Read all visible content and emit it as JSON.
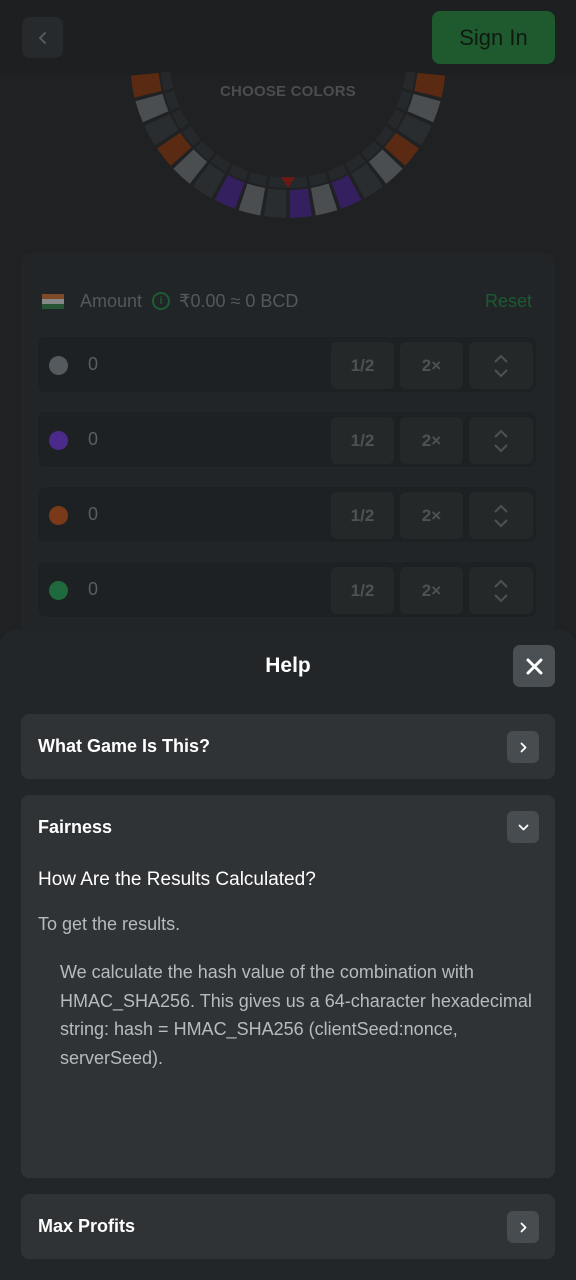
{
  "header": {
    "signin_label": "Sign In"
  },
  "wheel": {
    "title": "CHOOSE COLORS"
  },
  "amount": {
    "label": "Amount",
    "info_icon": "i",
    "value": "₹0.00 ≈ 0 BCD",
    "reset_label": "Reset"
  },
  "bets": [
    {
      "color_name": "gray",
      "color": "#555a5e",
      "value": "0",
      "half": "1/2",
      "double": "2×"
    },
    {
      "color_name": "purple",
      "color": "#4b2a8c",
      "value": "0",
      "half": "1/2",
      "double": "2×"
    },
    {
      "color_name": "orange",
      "color": "#7a3a1a",
      "value": "0",
      "half": "1/2",
      "double": "2×"
    },
    {
      "color_name": "green",
      "color": "#1e6a3c",
      "value": "0",
      "half": "1/2",
      "double": "2×"
    }
  ],
  "help": {
    "title": "Help",
    "sections": [
      {
        "title": "What Game Is This?"
      },
      {
        "title": "Fairness"
      },
      {
        "title": "Max Profits"
      }
    ],
    "fairness": {
      "question": "How Are the Results Calculated?",
      "intro": "To get the results.",
      "body": "We calculate the hash value of the combination with HMAC_SHA256. This gives us a 64-character hexadecimal string: hash = HMAC_SHA256 (clientSeed:nonce, serverSeed)."
    }
  },
  "colors": {
    "accent_green": "#1f5a2e",
    "sheet_bg": "#232628"
  }
}
